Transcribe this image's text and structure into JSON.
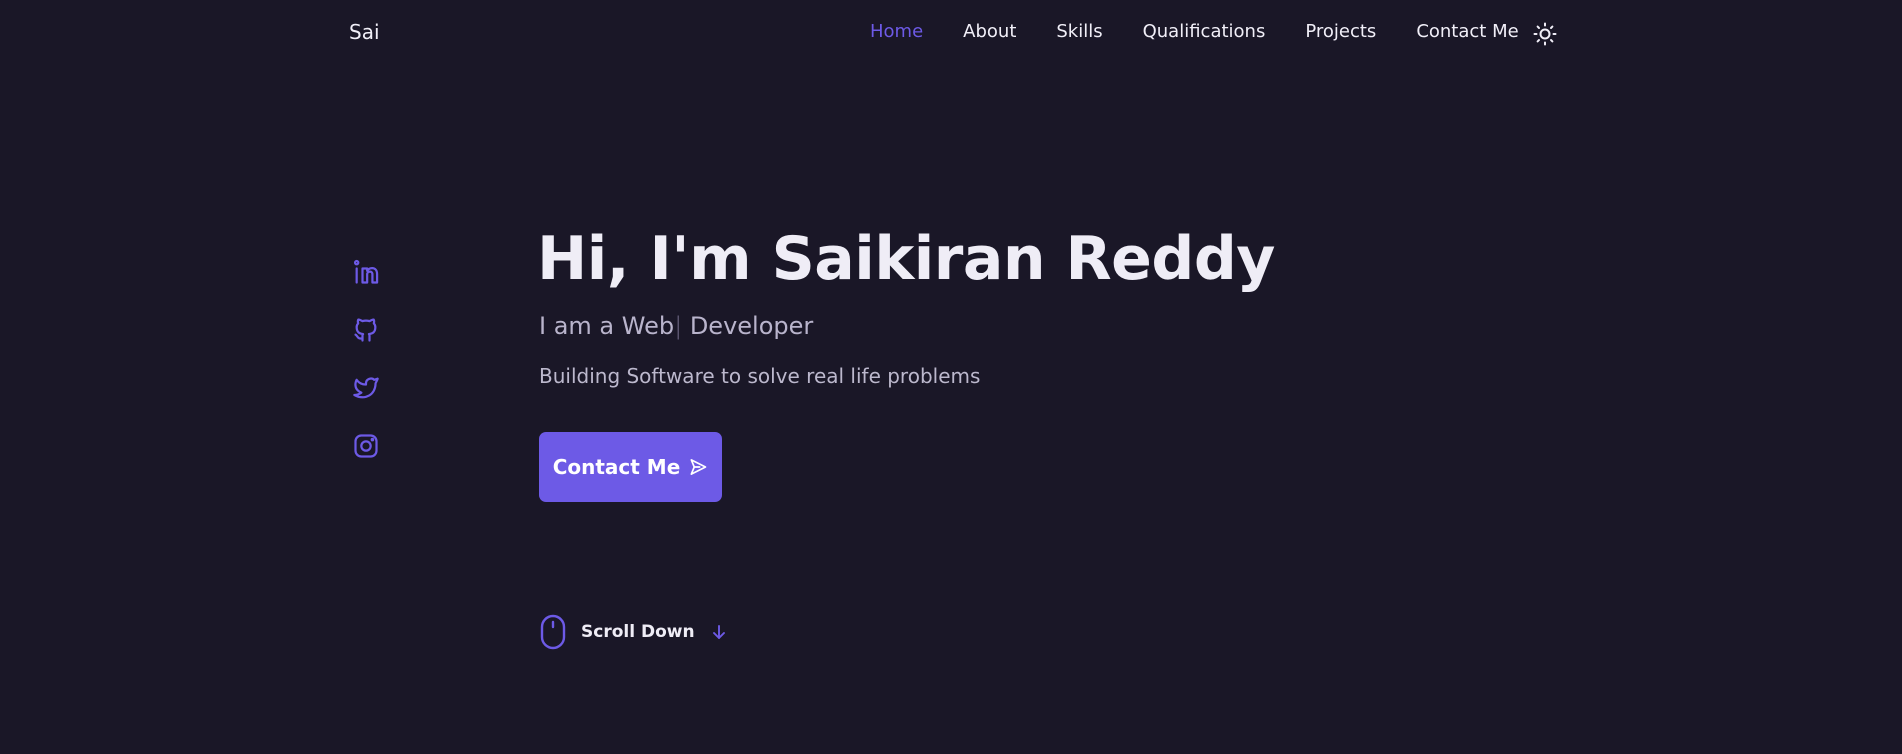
{
  "header": {
    "logo": "Sai",
    "nav": [
      "Home",
      "About",
      "Skills",
      "Qualifications",
      "Projects",
      "Contact Me"
    ],
    "active_nav": "Home",
    "theme_icon": "sun-icon"
  },
  "socials": [
    {
      "name": "linkedin-icon"
    },
    {
      "name": "github-icon"
    },
    {
      "name": "twitter-icon"
    },
    {
      "name": "instagram-icon"
    }
  ],
  "hero": {
    "title": "Hi, I'm Saikiran Reddy",
    "subtitle_prefix": "I am a Web",
    "subtitle_cursor": "|",
    "subtitle_suffix": " Developer",
    "description": "Building Software to solve real life problems",
    "cta_label": "Contact Me",
    "cta_icon": "send-icon"
  },
  "scroll": {
    "label": "Scroll Down",
    "mouse_icon": "mouse-icon",
    "arrow_icon": "arrow-down-icon"
  },
  "colors": {
    "background": "#1a1727",
    "accent": "#6d5ae6",
    "text": "#efedf6",
    "muted": "#b9b4cc"
  }
}
